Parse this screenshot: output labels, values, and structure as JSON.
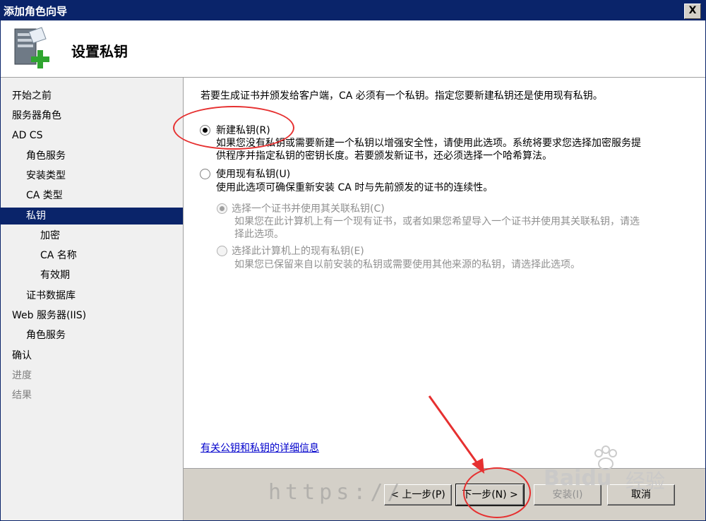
{
  "window": {
    "title": "添加角色向导",
    "close_glyph": "X"
  },
  "header": {
    "title": "设置私钥",
    "icon": "server-add-icon"
  },
  "sidebar": {
    "items": [
      {
        "label": "开始之前",
        "state": "normal"
      },
      {
        "label": "服务器角色",
        "state": "normal"
      },
      {
        "label": "AD CS",
        "state": "normal"
      },
      {
        "label": "角色服务",
        "state": "normal"
      },
      {
        "label": "安装类型",
        "state": "normal"
      },
      {
        "label": "CA 类型",
        "state": "normal"
      },
      {
        "label": "私钥",
        "state": "selected"
      },
      {
        "label": "加密",
        "state": "normal"
      },
      {
        "label": "CA 名称",
        "state": "normal"
      },
      {
        "label": "有效期",
        "state": "normal"
      },
      {
        "label": "证书数据库",
        "state": "normal"
      },
      {
        "label": "Web 服务器(IIS)",
        "state": "normal"
      },
      {
        "label": "角色服务",
        "state": "normal"
      },
      {
        "label": "确认",
        "state": "normal"
      },
      {
        "label": "进度",
        "state": "disabled"
      },
      {
        "label": "结果",
        "state": "disabled"
      }
    ]
  },
  "content": {
    "intro": "若要生成证书并颁发给客户端，CA 必须有一个私钥。指定您要新建私钥还是使用现有私钥。",
    "option_new": {
      "label": "新建私钥(R)",
      "desc_line1": "如果您没有私钥或需要新建一个私钥以增强安全性，请使用此选项。系统将要求您选择加密服务提",
      "desc_line2": "供程序并指定私钥的密钥长度。若要颁发新证书，还必须选择一个哈希算法。",
      "checked": true
    },
    "option_existing": {
      "label": "使用现有私钥(U)",
      "desc": "使用此选项可确保重新安装 CA 时与先前颁发的证书的连续性。",
      "checked": false
    },
    "sub_cert": {
      "label": "选择一个证书并使用其关联私钥(C)",
      "desc_line1": "如果您在此计算机上有一个现有证书，或者如果您希望导入一个证书并使用其关联私钥，请选",
      "desc_line2": "择此选项。",
      "checked": true
    },
    "sub_key": {
      "label": "选择此计算机上的现有私钥(E)",
      "desc": "如果您已保留来自以前安装的私钥或需要使用其他来源的私钥，请选择此选项。",
      "checked": false
    },
    "more_info_link": "有关公钥和私钥的详细信息"
  },
  "footer": {
    "prev": "< 上一步(P)",
    "next": "下一步(N) >",
    "install": "安装(I)",
    "cancel": "取消"
  },
  "watermark": "https://",
  "baidu": {
    "brand": "Baidu",
    "tag": "经验"
  }
}
